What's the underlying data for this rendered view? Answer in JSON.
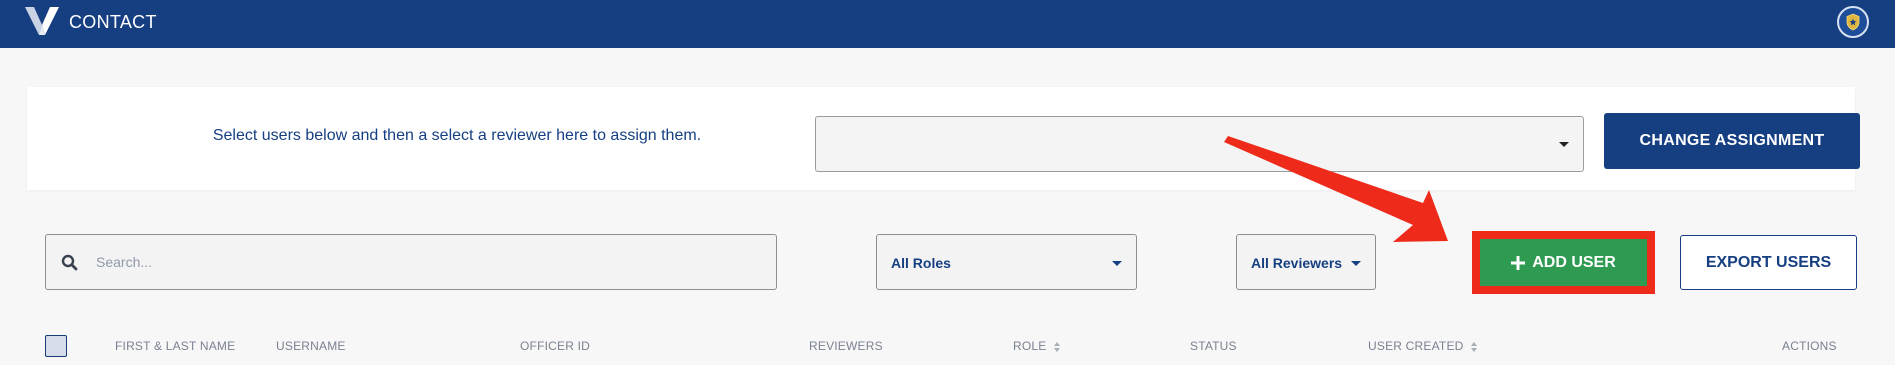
{
  "header": {
    "title": "CONTACT"
  },
  "assignment": {
    "instruction": "Select users below and then a select a reviewer here to assign them.",
    "reviewer_value": "",
    "change_button": "CHANGE ASSIGNMENT"
  },
  "filters": {
    "search_placeholder": "Search...",
    "roles_value": "All Roles",
    "reviewers_value": "All Reviewers",
    "add_user_button": "ADD USER",
    "export_button": "EXPORT USERS"
  },
  "table": {
    "columns": [
      "FIRST & LAST NAME",
      "USERNAME",
      "OFFICER ID",
      "REVIEWERS",
      "ROLE",
      "STATUS",
      "USER CREATED",
      "ACTIONS"
    ]
  },
  "colors": {
    "header_bg": "#163f82",
    "primary": "#163f82",
    "add_user_green": "#2e9a52",
    "annotation_red": "#ee2b1a"
  },
  "icons": {
    "logo": "v-logo-icon",
    "profile": "badge-star-icon",
    "search": "search-icon",
    "dropdown": "chevron-down-icon",
    "add": "plus-icon",
    "sort": "sort-icon",
    "annotation": "arrow-icon"
  }
}
